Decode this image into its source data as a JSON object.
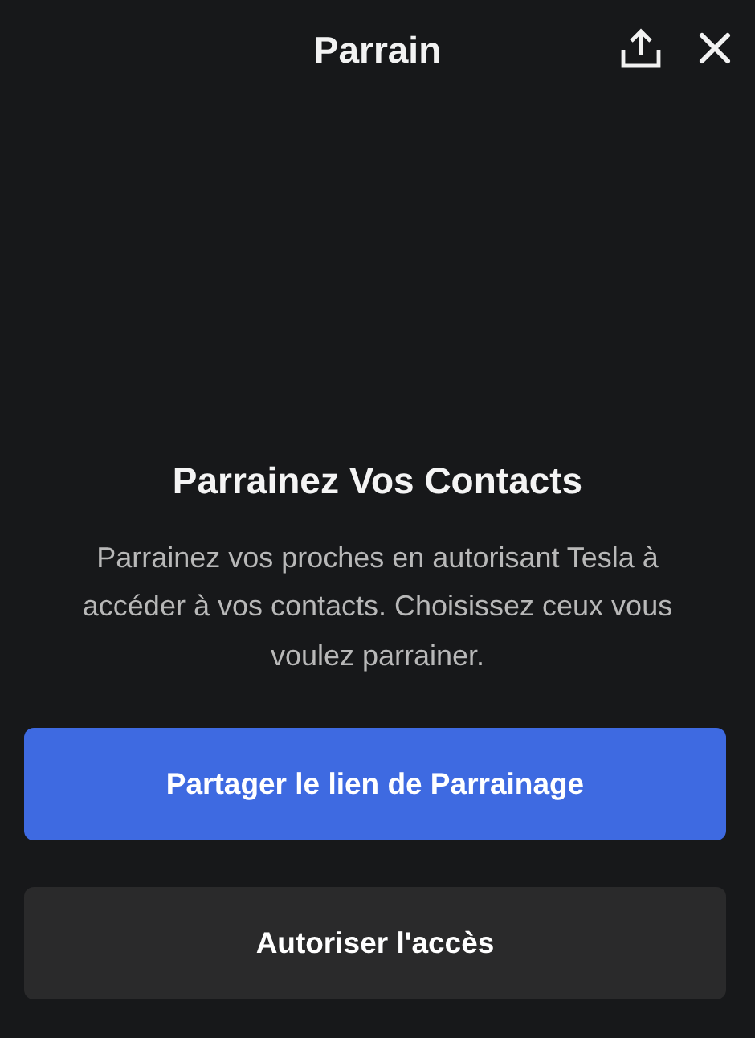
{
  "header": {
    "title": "Parrain"
  },
  "heading": "Parrainez Vos Contacts",
  "description": "Parrainez vos proches en autorisant Tesla à accéder à vos contacts. Choisissez ceux vous voulez parrainer.",
  "buttons": [
    {
      "label": "Partager le lien de Parrainage",
      "kind": "primary"
    },
    {
      "label": "Autoriser l'accès",
      "kind": "secondary"
    }
  ]
}
